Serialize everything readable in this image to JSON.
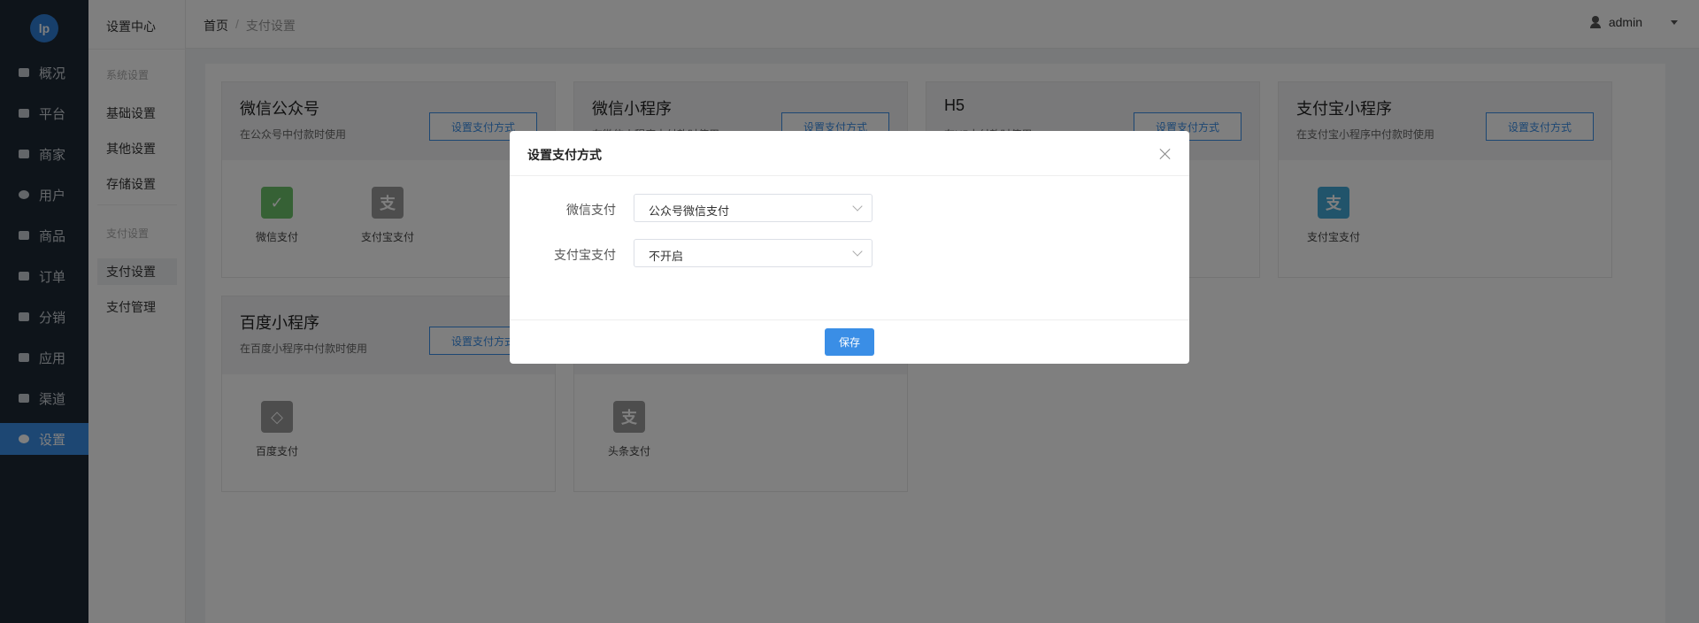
{
  "logo": "lp",
  "nav": [
    {
      "label": "概况",
      "icon": "chart-icon"
    },
    {
      "label": "平台",
      "icon": "monitor-icon"
    },
    {
      "label": "商家",
      "icon": "store-icon"
    },
    {
      "label": "用户",
      "icon": "user-icon"
    },
    {
      "label": "商品",
      "icon": "bag-icon"
    },
    {
      "label": "订单",
      "icon": "clipboard-icon"
    },
    {
      "label": "分销",
      "icon": "hierarchy-icon"
    },
    {
      "label": "应用",
      "icon": "grid-icon"
    },
    {
      "label": "渠道",
      "icon": "cluster-icon"
    },
    {
      "label": "设置",
      "icon": "gear-icon"
    }
  ],
  "subnav": {
    "title": "设置中心",
    "group1": "系统设置",
    "items1": [
      "基础设置",
      "其他设置",
      "存储设置"
    ],
    "group2": "支付设置",
    "items2": [
      "支付设置",
      "支付管理"
    ]
  },
  "breadcrumb": {
    "home": "首页",
    "sep": "/",
    "current": "支付设置"
  },
  "user": {
    "name": "admin"
  },
  "cards": [
    {
      "title": "微信公众号",
      "desc": "在公众号中付款时使用",
      "button": "设置支付方式",
      "pays": [
        {
          "label": "微信支付"
        },
        {
          "label": "支付宝支付"
        }
      ]
    },
    {
      "title": "微信小程序",
      "desc": "在微信小程序中付款时使用",
      "button": "设置支付方式",
      "pays": []
    },
    {
      "title": "H5",
      "desc": "在H5中付款时使用",
      "button": "设置支付方式",
      "pays": []
    },
    {
      "title": "支付宝小程序",
      "desc": "在支付宝小程序中付款时使用",
      "button": "设置支付方式",
      "pays": [
        {
          "label": "支付宝支付"
        }
      ]
    },
    {
      "title": "百度小程序",
      "desc": "在百度小程序中付款时使用",
      "button": "设置支付方式",
      "pays": [
        {
          "label": "百度支付"
        }
      ]
    },
    {
      "title": "",
      "desc": "",
      "button": "",
      "pays": [
        {
          "label": "头条支付"
        }
      ]
    }
  ],
  "colors": {
    "wechat": "#6dc36a",
    "alipay": "#43a8d6",
    "grey_icon": "#9a9a9a",
    "accent": "#3a8ee6"
  },
  "modal": {
    "title": "设置支付方式",
    "rows": [
      {
        "label": "微信支付",
        "value": "公众号微信支付"
      },
      {
        "label": "支付宝支付",
        "value": "不开启"
      }
    ],
    "save": "保存"
  }
}
